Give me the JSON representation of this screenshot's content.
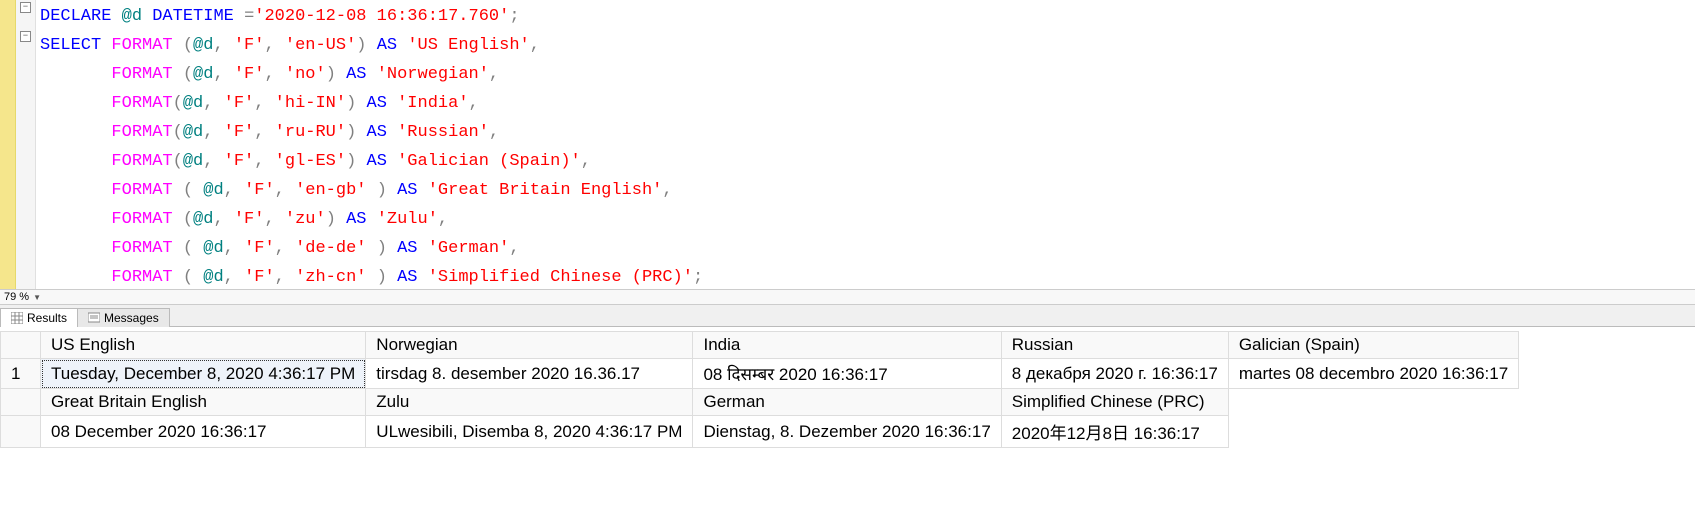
{
  "zoom": "79 %",
  "fold": [
    "−",
    "−"
  ],
  "code": {
    "l1": {
      "declare": "DECLARE",
      "var": "@d",
      "type": "DATETIME",
      "eq": "=",
      "str": "'2020-12-08 16:36:17.760'",
      "semi": ";"
    },
    "l2": {
      "select": "SELECT",
      "fn": "FORMAT",
      "open": " (",
      "var": "@d",
      "c1": ",",
      "sp1": " ",
      "f": "'F'",
      "c2": ",",
      "sp2": " ",
      "loc": "'en-US'",
      "close": ")",
      "sp3": " ",
      "as": "AS",
      "sp4": " ",
      "alias": "'US English'",
      "comma": ","
    },
    "l3": {
      "indent": "       ",
      "fn": "FORMAT",
      "open": " (",
      "var": "@d",
      "c1": ",",
      "sp1": " ",
      "f": "'F'",
      "c2": ",",
      "sp2": " ",
      "loc": "'no'",
      "close": ")",
      "sp3": " ",
      "as": "AS",
      "sp4": " ",
      "alias": "'Norwegian'",
      "comma": ","
    },
    "l4": {
      "indent": "       ",
      "fn": "FORMAT",
      "open": "(",
      "var": "@d",
      "c1": ",",
      "sp1": " ",
      "f": "'F'",
      "c2": ",",
      "sp2": " ",
      "loc": "'hi-IN'",
      "close": ")",
      "sp3": " ",
      "as": "AS",
      "sp4": " ",
      "alias": "'India'",
      "comma": ","
    },
    "l5": {
      "indent": "       ",
      "fn": "FORMAT",
      "open": "(",
      "var": "@d",
      "c1": ",",
      "sp1": " ",
      "f": "'F'",
      "c2": ",",
      "sp2": " ",
      "loc": "'ru-RU'",
      "close": ")",
      "sp3": " ",
      "as": "AS",
      "sp4": " ",
      "alias": "'Russian'",
      "comma": ","
    },
    "l6": {
      "indent": "       ",
      "fn": "FORMAT",
      "open": "(",
      "var": "@d",
      "c1": ",",
      "sp1": " ",
      "f": "'F'",
      "c2": ",",
      "sp2": " ",
      "loc": "'gl-ES'",
      "close": ")",
      "sp3": " ",
      "as": "AS",
      "sp4": " ",
      "alias": "'Galician (Spain)'",
      "comma": ","
    },
    "l7": {
      "indent": "       ",
      "fn": "FORMAT",
      "open": " ( ",
      "var": "@d",
      "c1": ",",
      "sp1": " ",
      "f": "'F'",
      "c2": ",",
      "sp2": " ",
      "loc": "'en-gb'",
      "close": " )",
      "sp3": " ",
      "as": "AS",
      "sp4": " ",
      "alias": "'Great Britain English'",
      "comma": ","
    },
    "l8": {
      "indent": "       ",
      "fn": "FORMAT",
      "open": " (",
      "var": "@d",
      "c1": ",",
      "sp1": " ",
      "f": "'F'",
      "c2": ",",
      "sp2": " ",
      "loc": "'zu'",
      "close": ")",
      "sp3": " ",
      "as": "AS",
      "sp4": " ",
      "alias": "'Zulu'",
      "comma": ","
    },
    "l9": {
      "indent": "       ",
      "fn": "FORMAT",
      "open": " ( ",
      "var": "@d",
      "c1": ",",
      "sp1": " ",
      "f": "'F'",
      "c2": ",",
      "sp2": " ",
      "loc": "'de-de'",
      "close": " )",
      "sp3": " ",
      "as": "AS",
      "sp4": " ",
      "alias": "'German'",
      "comma": ","
    },
    "l10": {
      "indent": "       ",
      "fn": "FORMAT",
      "open": " ( ",
      "var": "@d",
      "c1": ",",
      "sp1": " ",
      "f": "'F'",
      "c2": ",",
      "sp2": " ",
      "loc": "'zh-cn'",
      "close": " )",
      "sp3": " ",
      "as": "AS",
      "sp4": " ",
      "alias": "'Simplified Chinese (PRC)'",
      "semi": ";"
    }
  },
  "tabs": {
    "results": "Results",
    "messages": "Messages"
  },
  "grid": {
    "rownum": "1",
    "headers1": [
      "US English",
      "Norwegian",
      "India",
      "Russian",
      "Galician (Spain)"
    ],
    "row1": [
      "Tuesday, December 8, 2020 4:36:17 PM",
      "tirsdag 8. desember 2020 16.36.17",
      "08 दिसम्बर 2020 16:36:17",
      "8 декабря 2020 г. 16:36:17",
      "martes 08 decembro 2020 16:36:17"
    ],
    "headers2": [
      "Great Britain English",
      "Zulu",
      "German",
      "Simplified Chinese (PRC)"
    ],
    "row2": [
      "08 December 2020 16:36:17",
      "ULwesibili, Disemba 8, 2020 4:36:17 PM",
      "Dienstag, 8. Dezember 2020 16:36:17",
      "2020年12月8日 16:36:17"
    ]
  }
}
